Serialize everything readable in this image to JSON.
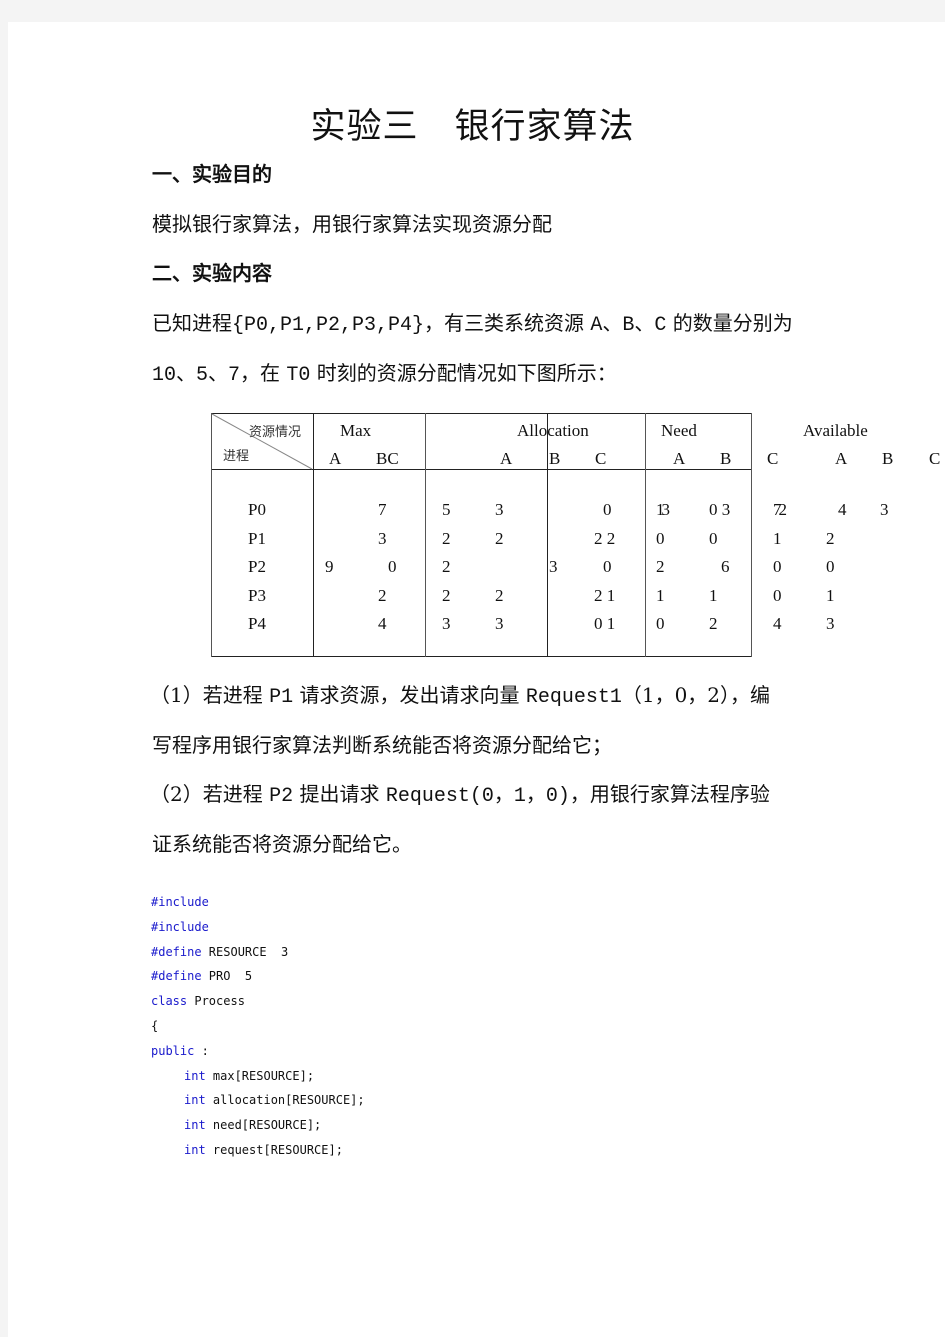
{
  "document": {
    "title_part1": "实验三",
    "title_part2": "银行家算法",
    "sections": [
      {
        "heading": "一、实验目的",
        "paragraph": "模拟银行家算法，用银行家算法实现资源分配"
      },
      {
        "heading": "二、实验内容"
      }
    ],
    "intro_line1_pre": "已知进程",
    "intro_line1_set": "{P0,P1,P2,P3,P4}",
    "intro_line1_mid": "，有三类系统资源 ",
    "intro_line1_res": "A、B、C",
    "intro_line1_post": " 的数量分别为",
    "intro_line2_nums": "10、5、7",
    "intro_line2_mid": "，在 ",
    "intro_line2_t0": "T0",
    "intro_line2_post": " 时刻的资源分配情况如下图所示：",
    "questions": [
      {
        "prefix": "（1）若进程 ",
        "proc": "P1",
        "mid": " 请求资源，发出请求向量 ",
        "req": "Request1",
        "vec": "（1，0，2）",
        "tail": "，编",
        "line2": "写程序用银行家算法判断系统能否将资源分配给它；"
      },
      {
        "prefix": "（2）若进程 ",
        "proc": "P2",
        "mid": " 提出请求 ",
        "req": "Request(0，1，0)",
        "tail": "，用银行家算法程序验",
        "line2": "证系统能否将资源分配给它。"
      }
    ]
  },
  "table": {
    "corner_top": "资源情况",
    "corner_bottom": "进程",
    "group_headers": {
      "max": "Max",
      "allocation": "Allocation",
      "need": "Need",
      "available": "Available"
    },
    "sub_headers": {
      "max": [
        "A",
        "BC"
      ],
      "allocation": [
        "A",
        "B",
        "C"
      ],
      "need": [
        "A",
        "B"
      ],
      "available": [
        "C",
        "A",
        "B",
        "C"
      ]
    },
    "rows": [
      {
        "process": "P0",
        "max_a": "",
        "max_bc": "7",
        "alloc_1": "5",
        "alloc_2": "3",
        "alloc_3": "",
        "alloc_4": "0",
        "need_1": "13",
        "need_2": "0 3",
        "avail_1": "72",
        "avail_2": "4",
        "avail_3": "3"
      },
      {
        "process": "P1",
        "max_a": "",
        "max_bc": "3",
        "alloc_1": "2",
        "alloc_2": "2",
        "alloc_3": "",
        "alloc_4": "2 2",
        "need_1": "0",
        "need_2": "0",
        "avail_1": "1",
        "avail_2": "2",
        "avail_3": ""
      },
      {
        "process": "P2",
        "max_a": "9",
        "max_bc": "0",
        "alloc_1": "2",
        "alloc_2": "",
        "alloc_3": "3",
        "alloc_4": "0",
        "need_1": "2",
        "need_2": "6",
        "avail_1": "0",
        "avail_2": "0",
        "avail_3": ""
      },
      {
        "process": "P3",
        "max_a": "",
        "max_bc": "2",
        "alloc_1": "2",
        "alloc_2": "2",
        "alloc_3": "",
        "alloc_4": "2 1",
        "need_1": "1",
        "need_2": "1",
        "avail_1": "0",
        "avail_2": "1",
        "avail_3": ""
      },
      {
        "process": "P4",
        "max_a": "",
        "max_bc": "4",
        "alloc_1": "3",
        "alloc_2": "3",
        "alloc_3": "",
        "alloc_4": "0 1",
        "need_1": "0",
        "need_2": "2",
        "avail_1": "4",
        "avail_2": "3",
        "avail_3": ""
      }
    ]
  },
  "code": {
    "lines": [
      {
        "kw": "#include",
        "rest": ""
      },
      {
        "kw": "#include",
        "rest": ""
      },
      {
        "kw": "#define",
        "rest": " RESOURCE  3"
      },
      {
        "kw": "#define",
        "rest": " PRO  5"
      },
      {
        "kw": "class",
        "rest": " Process"
      },
      {
        "kw": "",
        "rest": "{"
      },
      {
        "kw": "public",
        "rest": " :"
      },
      {
        "kw": "int",
        "rest": " max[RESOURCE];",
        "indent": true
      },
      {
        "kw": "int",
        "rest": " allocation[RESOURCE];",
        "indent": true
      },
      {
        "kw": "int",
        "rest": " need[RESOURCE];",
        "indent": true
      },
      {
        "kw": "int",
        "rest": " request[RESOURCE];",
        "indent": true
      }
    ]
  }
}
